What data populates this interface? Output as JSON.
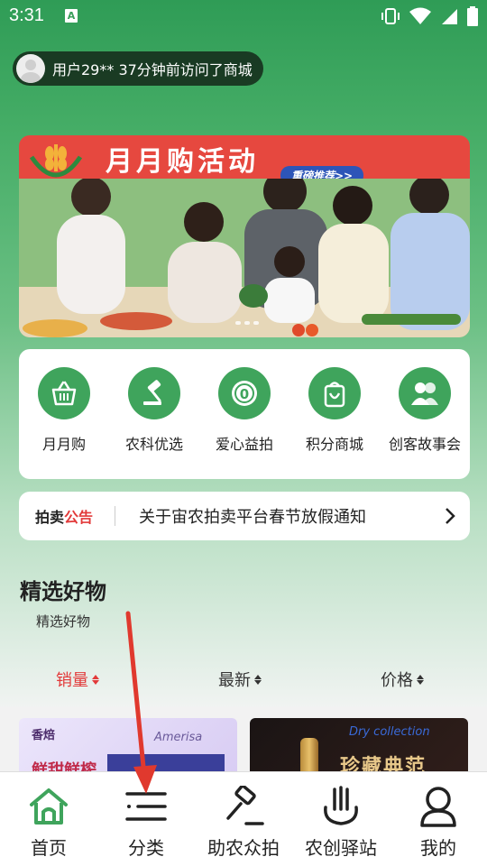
{
  "status": {
    "time": "3:31",
    "notification_icon": "a-icon",
    "right_icons": [
      "vibrate-icon",
      "wifi-icon",
      "signal-icon",
      "battery-icon"
    ]
  },
  "visit_notice": {
    "text": "用户29** 37分钟前访问了商城"
  },
  "banner": {
    "title": "月月购活动",
    "tag": "重磅推荐>>"
  },
  "quick_menu": [
    {
      "label": "月月购",
      "icon": "basket-icon"
    },
    {
      "label": "农科优选",
      "icon": "gavel-icon"
    },
    {
      "label": "爱心益拍",
      "icon": "coin-icon"
    },
    {
      "label": "积分商城",
      "icon": "shopping-bag-icon"
    },
    {
      "label": "创客故事会",
      "icon": "people-icon"
    }
  ],
  "notice": {
    "tag_a": "拍卖",
    "tag_b": "公告",
    "text": "关于宙农拍卖平台春节放假通知"
  },
  "section": {
    "title": "精选好物",
    "subtitle": "精选好物"
  },
  "sort_tabs": [
    {
      "label": "销量",
      "active": true
    },
    {
      "label": "最新",
      "active": false
    },
    {
      "label": "价格",
      "active": false
    }
  ],
  "goods": [
    {
      "brand": "香焙",
      "script": "Amerisa",
      "red_text": "鲜甜鲜榨"
    },
    {
      "script": "Dry collection",
      "title": "珍藏典范"
    }
  ],
  "bottom_nav": [
    {
      "label": "首页",
      "icon": "home-icon"
    },
    {
      "label": "分类",
      "icon": "list-icon"
    },
    {
      "label": "助农众拍",
      "icon": "auction-hammer-icon"
    },
    {
      "label": "农创驿站",
      "icon": "station-icon"
    },
    {
      "label": "我的",
      "icon": "user-icon"
    }
  ],
  "colors": {
    "primary_green": "#3fa45c",
    "accent_red": "#e23a3a",
    "annotation_red": "#e0392e"
  }
}
